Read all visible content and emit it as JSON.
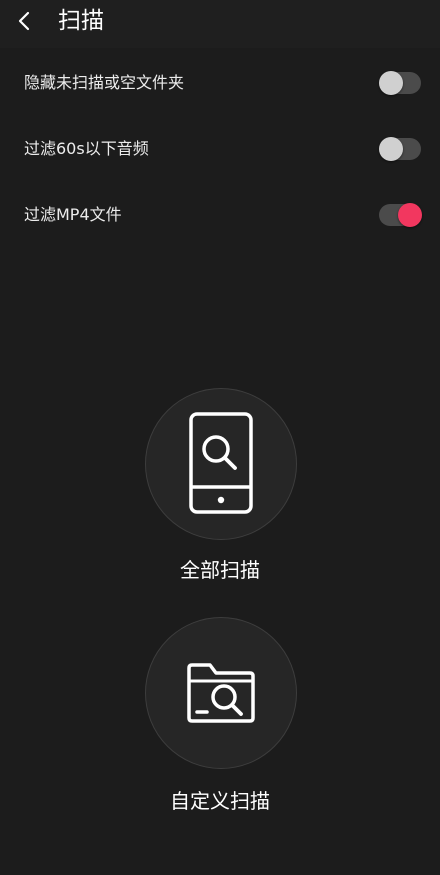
{
  "header": {
    "back_icon": "chevron-left-icon",
    "title": "扫描"
  },
  "settings": [
    {
      "label": "隐藏未扫描或空文件夹",
      "enabled": false
    },
    {
      "label": "过滤60s以下音频",
      "enabled": false
    },
    {
      "label": "过滤MP4文件",
      "enabled": true
    }
  ],
  "scan_options": {
    "full_scan": {
      "icon": "phone-search-icon",
      "label": "全部扫描"
    },
    "custom_scan": {
      "icon": "folder-search-icon",
      "label": "自定义扫描"
    }
  },
  "colors": {
    "background": "#1c1c1c",
    "accent": "#f2375f",
    "toggle_off_track": "#4b4b4b"
  }
}
